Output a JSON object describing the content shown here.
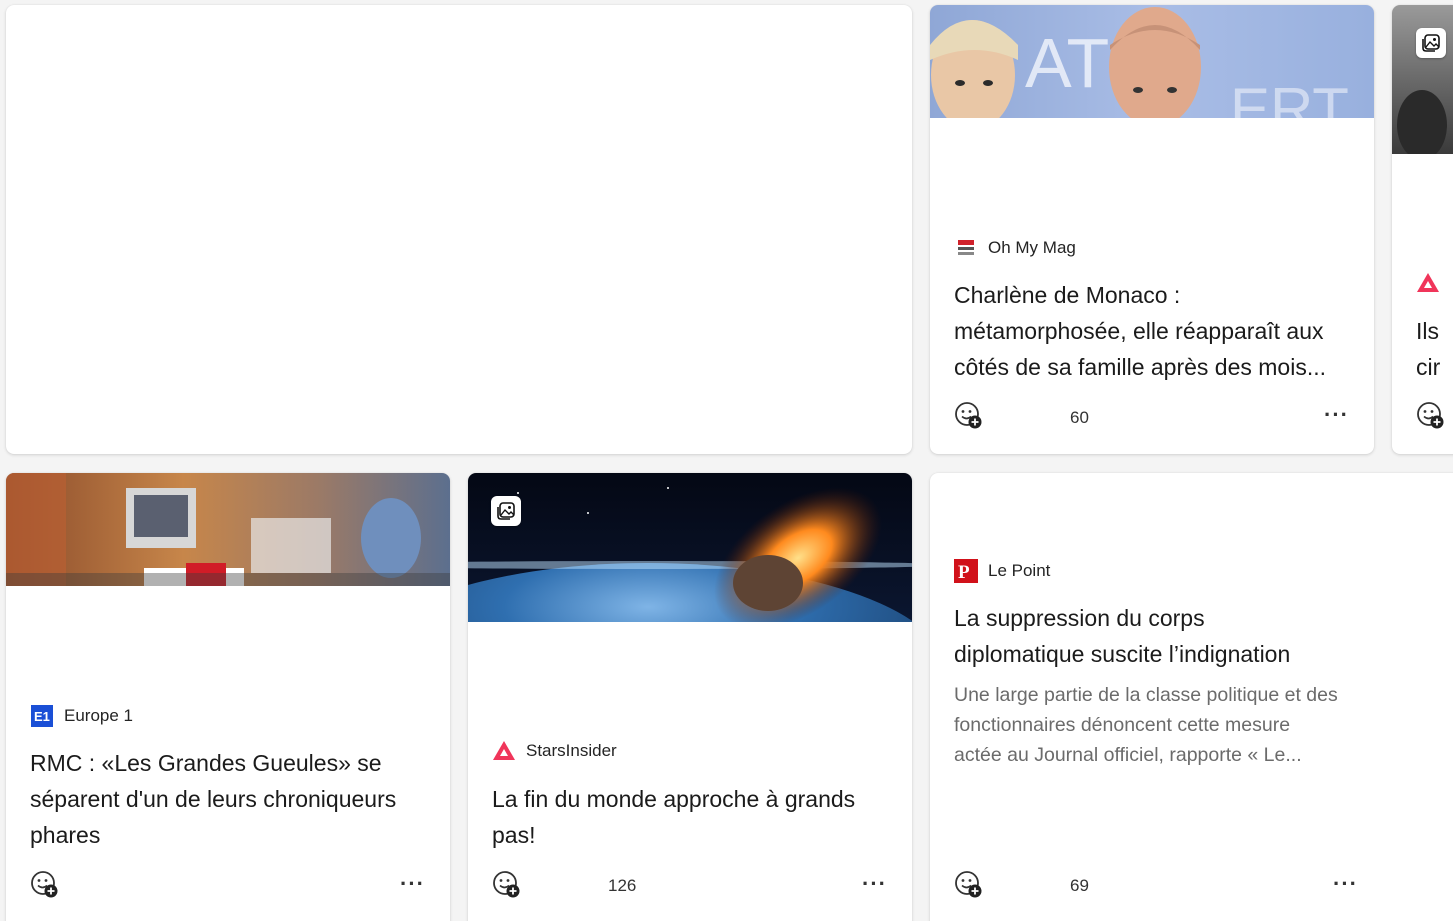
{
  "cards": {
    "monaco": {
      "source": "Oh My Mag",
      "headline_lines": [
        "Charlène de Monaco :",
        "métamorphosée, elle réapparaît aux",
        "côtés de sa famille après des mois..."
      ],
      "reactions": "60"
    },
    "partial_right": {
      "headline_lines": [
        "Ils",
        "cir"
      ]
    },
    "europe1": {
      "source": "Europe 1",
      "headline_lines": [
        "RMC : «Les Grandes Gueules» se",
        "séparent d'un de leurs chroniqueurs",
        "phares"
      ]
    },
    "starsinsider": {
      "source": "StarsInsider",
      "headline_lines": [
        "La fin du monde approche à grands",
        "pas!"
      ],
      "reactions": "126"
    },
    "lepoint": {
      "source": "Le Point",
      "headline_lines": [
        "La suppression du corps",
        "diplomatique suscite l’indignation"
      ],
      "abstract_lines": [
        "Une large partie de la classe politique et des",
        "fonctionnaires dénoncent cette mesure",
        "actée au Journal officiel, rapporte « Le..."
      ],
      "reactions": "69"
    }
  },
  "colors": {
    "starsinsider_red": "#f0355a",
    "lepoint_red": "#d1111a",
    "europe1_blue": "#1a4fd6"
  },
  "icons": {
    "reaction": "add-reaction-icon",
    "more": "more-options-icon",
    "gallery": "image-gallery-icon"
  }
}
